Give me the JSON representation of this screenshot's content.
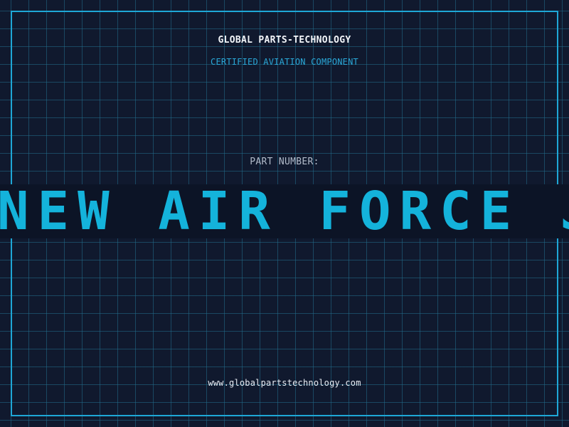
{
  "header": {
    "company": "GLOBAL PARTS-TECHNOLOGY",
    "subtitle": "CERTIFIED AVIATION COMPONENT"
  },
  "part": {
    "label": "PART NUMBER:",
    "value": "NEW AIR FORCE JETS"
  },
  "footer": {
    "url": "www.globalpartstechnology.com"
  },
  "colors": {
    "background": "#10192e",
    "grid": "#1c5a78",
    "accent": "#1ea7d6",
    "banner_text": "#14b3db",
    "title_text": "#f2f5f9"
  }
}
